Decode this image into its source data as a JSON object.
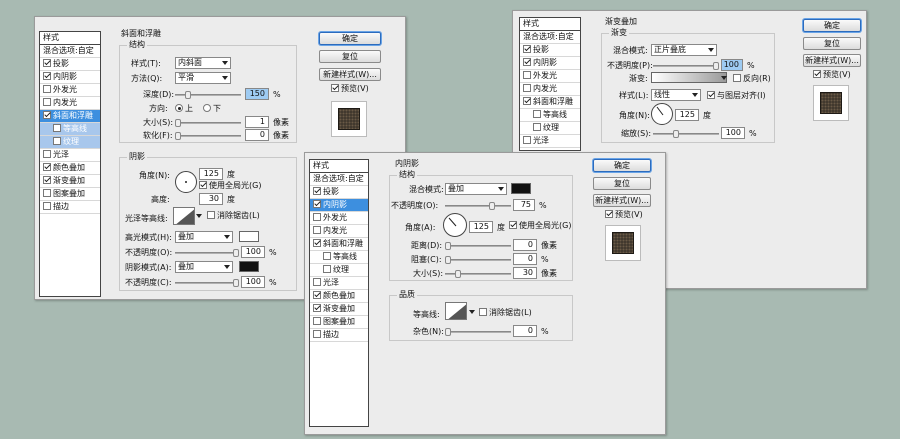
{
  "dlg1": {
    "sidebar": {
      "title": "样式",
      "items": [
        {
          "label": "混合选项:自定",
          "cb": null
        },
        {
          "label": "投影",
          "cb": true
        },
        {
          "label": "内阴影",
          "cb": true
        },
        {
          "label": "外发光",
          "cb": false
        },
        {
          "label": "内发光",
          "cb": false
        },
        {
          "label": "斜面和浮雕",
          "cb": true,
          "state": "sel"
        },
        {
          "label": "等高线",
          "cb": false,
          "state": "subsel",
          "sub": true
        },
        {
          "label": "纹理",
          "cb": false,
          "state": "subsel",
          "sub": true
        },
        {
          "label": "光泽",
          "cb": false
        },
        {
          "label": "颜色叠加",
          "cb": true
        },
        {
          "label": "渐变叠加",
          "cb": true
        },
        {
          "label": "图案叠加",
          "cb": false
        },
        {
          "label": "描边",
          "cb": false
        }
      ]
    },
    "section_title": "斜面和浮雕",
    "structure_title": "结构",
    "style_label": "样式(T):",
    "style_value": "内斜面",
    "method_label": "方法(Q):",
    "method_value": "平滑",
    "depth_label": "深度(D):",
    "depth_value": "150",
    "depth_unit": "%",
    "direction_label": "方向:",
    "dir_up": "上",
    "dir_down": "下",
    "size_label": "大小(S):",
    "size_value": "1",
    "size_unit": "像素",
    "soften_label": "软化(F):",
    "soften_value": "0",
    "soften_unit": "像素",
    "shading_title": "阴影",
    "angle_label": "角度(N):",
    "angle_value": "125",
    "angle_unit": "度",
    "global_light": "使用全局光(G)",
    "altitude_label": "高度:",
    "altitude_value": "30",
    "altitude_unit": "度",
    "gloss_label": "光泽等高线:",
    "antialias": "消除锯齿(L)",
    "hl_mode_label": "高光模式(H):",
    "hl_mode_value": "叠加",
    "hl_opacity_label": "不透明度(O):",
    "hl_opacity_value": "100",
    "hl_opacity_unit": "%",
    "sh_mode_label": "阴影模式(A):",
    "sh_mode_value": "叠加",
    "sh_opacity_label": "不透明度(C):",
    "sh_opacity_value": "100",
    "sh_opacity_unit": "%",
    "highlight_color": "#ffffff",
    "shadow_color": "#111111",
    "btn_ok": "确定",
    "btn_reset": "复位",
    "btn_new": "新建样式(W)...",
    "preview": "预览(V)"
  },
  "dlg2": {
    "section_title": "渐变叠加",
    "gradient_title": "渐变",
    "blend_label": "混合模式:",
    "blend_value": "正片叠底",
    "opacity_label": "不透明度(P):",
    "opacity_value": "100",
    "opacity_unit": "%",
    "grad_label": "渐变:",
    "reverse": "反向(R)",
    "style_label": "样式(L):",
    "style_value": "线性",
    "align": "与图层对齐(I)",
    "angle_label": "角度(N):",
    "angle_value": "125",
    "angle_unit": "度",
    "scale_label": "缩放(S):",
    "scale_value": "100",
    "scale_unit": "%",
    "sidebar": {
      "title": "样式",
      "items": [
        {
          "label": "混合选项:自定",
          "cb": null
        },
        {
          "label": "投影",
          "cb": true
        },
        {
          "label": "内阴影",
          "cb": true
        },
        {
          "label": "外发光",
          "cb": false
        },
        {
          "label": "内发光",
          "cb": false
        },
        {
          "label": "斜面和浮雕",
          "cb": true
        },
        {
          "label": "等高线",
          "cb": false,
          "sub": true
        },
        {
          "label": "纹理",
          "cb": false,
          "sub": true
        },
        {
          "label": "光泽",
          "cb": false
        }
      ]
    },
    "btn_ok": "确定",
    "btn_reset": "复位",
    "btn_new": "新建样式(W)...",
    "preview": "预览(V)"
  },
  "dlg3": {
    "sidebar": {
      "title": "样式",
      "items": [
        {
          "label": "混合选项:自定",
          "cb": null
        },
        {
          "label": "投影",
          "cb": true
        },
        {
          "label": "内阴影",
          "cb": true,
          "state": "sel"
        },
        {
          "label": "外发光",
          "cb": false
        },
        {
          "label": "内发光",
          "cb": false
        },
        {
          "label": "斜面和浮雕",
          "cb": true
        },
        {
          "label": "等高线",
          "cb": false,
          "sub": true
        },
        {
          "label": "纹理",
          "cb": false,
          "sub": true
        },
        {
          "label": "光泽",
          "cb": false
        },
        {
          "label": "颜色叠加",
          "cb": true
        },
        {
          "label": "渐变叠加",
          "cb": true
        },
        {
          "label": "图案叠加",
          "cb": false
        },
        {
          "label": "描边",
          "cb": false
        }
      ]
    },
    "section_title": "内阴影",
    "structure_title": "结构",
    "blend_label": "混合模式:",
    "blend_value": "叠加",
    "blend_color": "#111111",
    "opacity_label": "不透明度(O):",
    "opacity_value": "75",
    "opacity_unit": "%",
    "angle_label": "角度(A):",
    "angle_value": "125",
    "angle_unit": "度",
    "global_light": "使用全局光(G)",
    "distance_label": "距离(D):",
    "distance_value": "0",
    "distance_unit": "像素",
    "choke_label": "阻塞(C):",
    "choke_value": "0",
    "choke_unit": "%",
    "size_label": "大小(S):",
    "size_value": "30",
    "size_unit": "像素",
    "quality_title": "品质",
    "contour_label": "等高线:",
    "antialias": "消除锯齿(L)",
    "noise_label": "杂色(N):",
    "noise_value": "0",
    "noise_unit": "%",
    "btn_ok": "确定",
    "btn_reset": "复位",
    "btn_new": "新建样式(W)...",
    "preview": "预览(V)"
  }
}
